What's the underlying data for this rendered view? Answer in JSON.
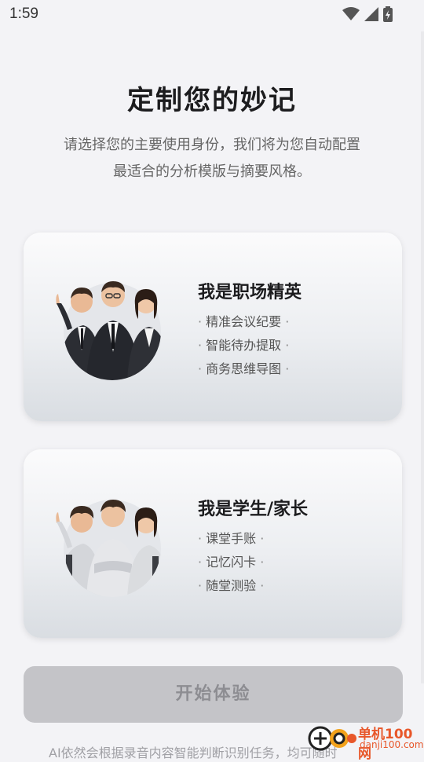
{
  "status_bar": {
    "time": "1:59"
  },
  "header": {
    "title": "定制您的妙记",
    "subtitle_line1": "请选择您的主要使用身份，我们将为您自动配置",
    "subtitle_line2": "最适合的分析模版与摘要风格。"
  },
  "cards": [
    {
      "title": "我是职场精英",
      "items": [
        "精准会议纪要",
        "智能待办提取",
        "商务思维导图"
      ],
      "illustration": "business-people-illustration"
    },
    {
      "title": "我是学生/家长",
      "items": [
        "课堂手账",
        "记忆闪卡",
        "随堂测验"
      ],
      "illustration": "students-illustration"
    }
  ],
  "cta": {
    "label": "开始体验"
  },
  "footer": {
    "note": "AI依然会根据录音内容智能判断识别任务，均可随时"
  },
  "watermark": {
    "cn": "单机100网",
    "en": "danji100.com"
  },
  "colors": {
    "background": "#f3f3f6",
    "cta_disabled": "#c4c4c8",
    "watermark": "#e8572a"
  }
}
